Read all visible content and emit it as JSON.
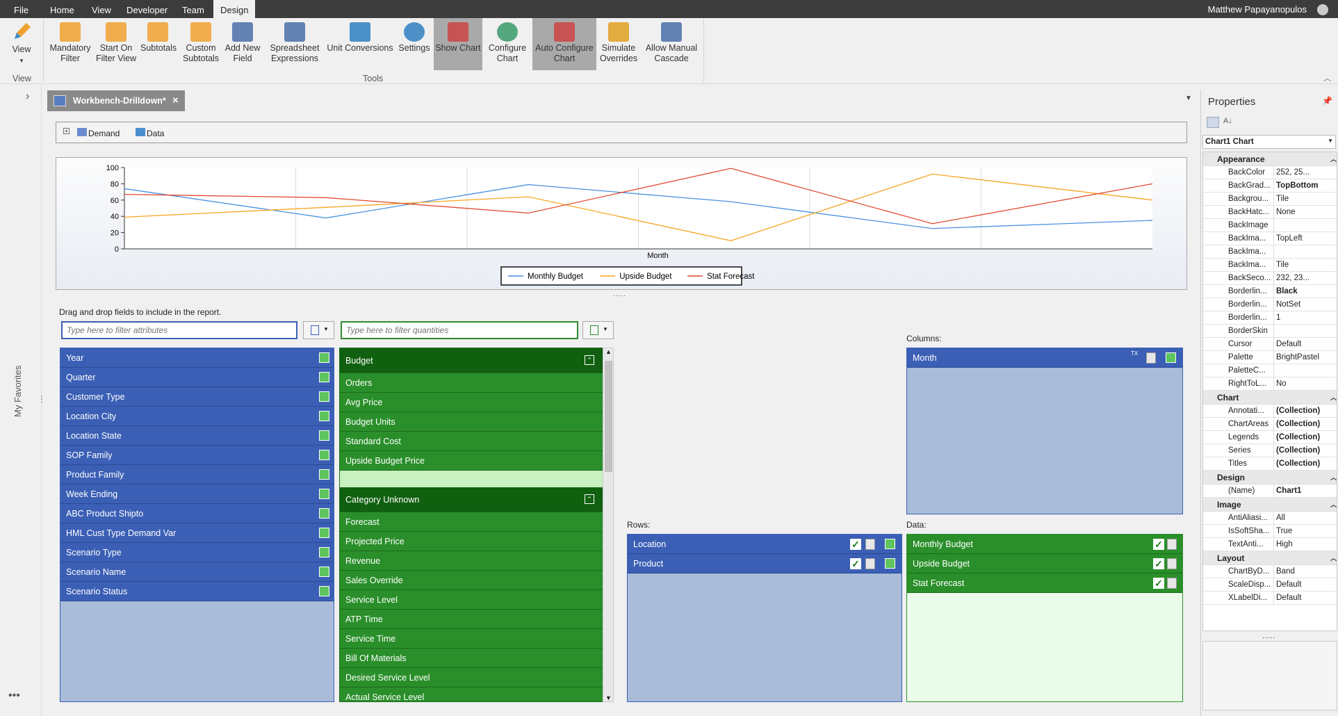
{
  "menu": {
    "items": [
      "File",
      "Home",
      "View",
      "Developer",
      "Team",
      "Design"
    ],
    "user": "Matthew Papayanopulos"
  },
  "ribbon": {
    "view_label": "View",
    "view_group": "View",
    "tools_group": "Tools",
    "buttons": [
      {
        "label": "Mandatory\nFilter"
      },
      {
        "label": "Start On\nFilter View"
      },
      {
        "label": "Subtotals"
      },
      {
        "label": "Custom\nSubtotals"
      },
      {
        "label": "Add New\nField"
      },
      {
        "label": "Spreadsheet\nExpressions"
      },
      {
        "label": "Unit Conversions"
      },
      {
        "label": "Settings"
      },
      {
        "label": "Show Chart"
      },
      {
        "label": "Configure\nChart"
      },
      {
        "label": "Auto Configure\nChart"
      },
      {
        "label": "Simulate\nOverrides"
      },
      {
        "label": "Allow Manual\nCascade"
      }
    ]
  },
  "left_strip": {
    "favorites": "My Favorites"
  },
  "doc_tab": {
    "title": "Workbench-Drilldown*",
    "close": "×"
  },
  "breadcrumb": {
    "demand": "Demand",
    "data": "Data"
  },
  "chart_data": {
    "type": "line",
    "categories": [
      "",
      "",
      "",
      "",
      "",
      "",
      ""
    ],
    "xlabel": "Month",
    "ylim": [
      0,
      100
    ],
    "yticks": [
      0,
      20,
      40,
      60,
      80,
      100
    ],
    "series": [
      {
        "name": "Monthly Budget",
        "color": "#4a90e2",
        "values": [
          74,
          38,
          79,
          58,
          25,
          35,
          null
        ]
      },
      {
        "name": "Upside Budget",
        "color": "#f5a623",
        "values": [
          39,
          51,
          64,
          10,
          92,
          60,
          null
        ]
      },
      {
        "name": "Stat Forecast",
        "color": "#e04a2f",
        "values": [
          67,
          63,
          44,
          99,
          31,
          80,
          null
        ]
      }
    ],
    "legend_position": "bottom"
  },
  "chart_x_points": [
    0,
    0.196,
    0.393,
    0.59,
    0.786,
    1.0
  ],
  "fields": {
    "instructions": "Drag and drop fields to include in the report.",
    "attr_placeholder": "Type here to filter attributes",
    "qty_placeholder": "Type here to filter quantities",
    "attributes": [
      "Year",
      "Quarter",
      "Customer Type",
      "Location City",
      "Location State",
      "SOP Family",
      "Product Family",
      "Week Ending",
      "ABC Product Shipto",
      "HML Cust Type Demand Var",
      "Scenario Type",
      "Scenario Name",
      "Scenario Status"
    ],
    "budget_header": "Budget",
    "budget_items": [
      "Orders",
      "Avg Price",
      "Budget Units",
      "Standard Cost",
      "Upside Budget Price"
    ],
    "unknown_header": "Category Unknown",
    "unknown_items": [
      "Forecast",
      "Projected Price",
      "Revenue",
      "Sales Override",
      "Service Level",
      "ATP Time",
      "Service Time",
      "Bill Of Materials",
      "Desired Service Level",
      "Actual Service Level"
    ]
  },
  "layout_zones": {
    "columns_label": "Columns:",
    "columns": [
      "Month"
    ],
    "rows_label": "Rows:",
    "rows": [
      "Location",
      "Product"
    ],
    "data_label": "Data:",
    "data": [
      "Monthly Budget",
      "Upside Budget",
      "Stat Forecast"
    ]
  },
  "properties": {
    "title": "Properties",
    "object": "Chart1  Chart",
    "categories": [
      {
        "name": "Appearance",
        "rows": [
          [
            "BackColor",
            "252, 25..."
          ],
          [
            "BackGrad...",
            "TopBottom"
          ],
          [
            "Backgrou...",
            "Tile"
          ],
          [
            "BackHatc...",
            "None"
          ],
          [
            "BackImage",
            ""
          ],
          [
            "BackIma...",
            "TopLeft"
          ],
          [
            "BackIma...",
            ""
          ],
          [
            "BackIma...",
            "Tile"
          ],
          [
            "BackSeco...",
            "232, 23..."
          ],
          [
            "Borderlin...",
            "Black"
          ],
          [
            "Borderlin...",
            "NotSet"
          ],
          [
            "Borderlin...",
            "1"
          ],
          [
            "BorderSkin",
            ""
          ],
          [
            "Cursor",
            "Default"
          ],
          [
            "Palette",
            "BrightPastel"
          ],
          [
            "PaletteC...",
            ""
          ],
          [
            "RightToL...",
            "No"
          ]
        ]
      },
      {
        "name": "Chart",
        "rows": [
          [
            "Annotati...",
            "(Collection)"
          ],
          [
            "ChartAreas",
            "(Collection)"
          ],
          [
            "Legends",
            "(Collection)"
          ],
          [
            "Series",
            "(Collection)"
          ],
          [
            "Titles",
            "(Collection)"
          ]
        ]
      },
      {
        "name": "Design",
        "rows": [
          [
            "(Name)",
            "Chart1"
          ]
        ]
      },
      {
        "name": "Image",
        "rows": [
          [
            "AntiAliasi...",
            "All"
          ],
          [
            "IsSoftSha...",
            "True"
          ],
          [
            "TextAnti...",
            "High"
          ]
        ]
      },
      {
        "name": "Layout",
        "rows": [
          [
            "ChartByD...",
            "Band"
          ],
          [
            "ScaleDisp...",
            "Default"
          ],
          [
            "XLabelDi...",
            "Default"
          ]
        ]
      }
    ]
  }
}
